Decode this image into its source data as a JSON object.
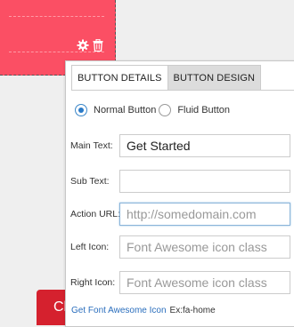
{
  "bottom_button": {
    "label": "Cl"
  },
  "tabs": [
    {
      "label": "BUTTON DETAILS",
      "active": true
    },
    {
      "label": "BUTTON DESIGN",
      "active": false
    }
  ],
  "style_options": {
    "normal": {
      "label": "Normal Button",
      "selected": true
    },
    "fluid": {
      "label": "Fluid Button",
      "selected": false
    }
  },
  "fields": {
    "main_text": {
      "label": "Main Text:",
      "value": "Get Started",
      "placeholder": ""
    },
    "sub_text": {
      "label": "Sub Text:",
      "value": "",
      "placeholder": ""
    },
    "action_url": {
      "label": "Action URL:",
      "value": "",
      "placeholder": "http://somedomain.com"
    },
    "left_icon": {
      "label": "Left Icon:",
      "value": "",
      "placeholder": "Font Awesome icon class"
    },
    "right_icon": {
      "label": "Right Icon:",
      "value": "",
      "placeholder": "Font Awesome icon class"
    }
  },
  "footer": {
    "link_label": "Get Font Awesome Icon",
    "example": "Ex:fa-home"
  },
  "icons": [
    "gear-icon",
    "trash-icon"
  ],
  "colors": {
    "red_block": "#fb4f64",
    "bottom_button": "#d5212e",
    "link": "#2a6ebd",
    "radio_accent": "#2a7ac7"
  }
}
